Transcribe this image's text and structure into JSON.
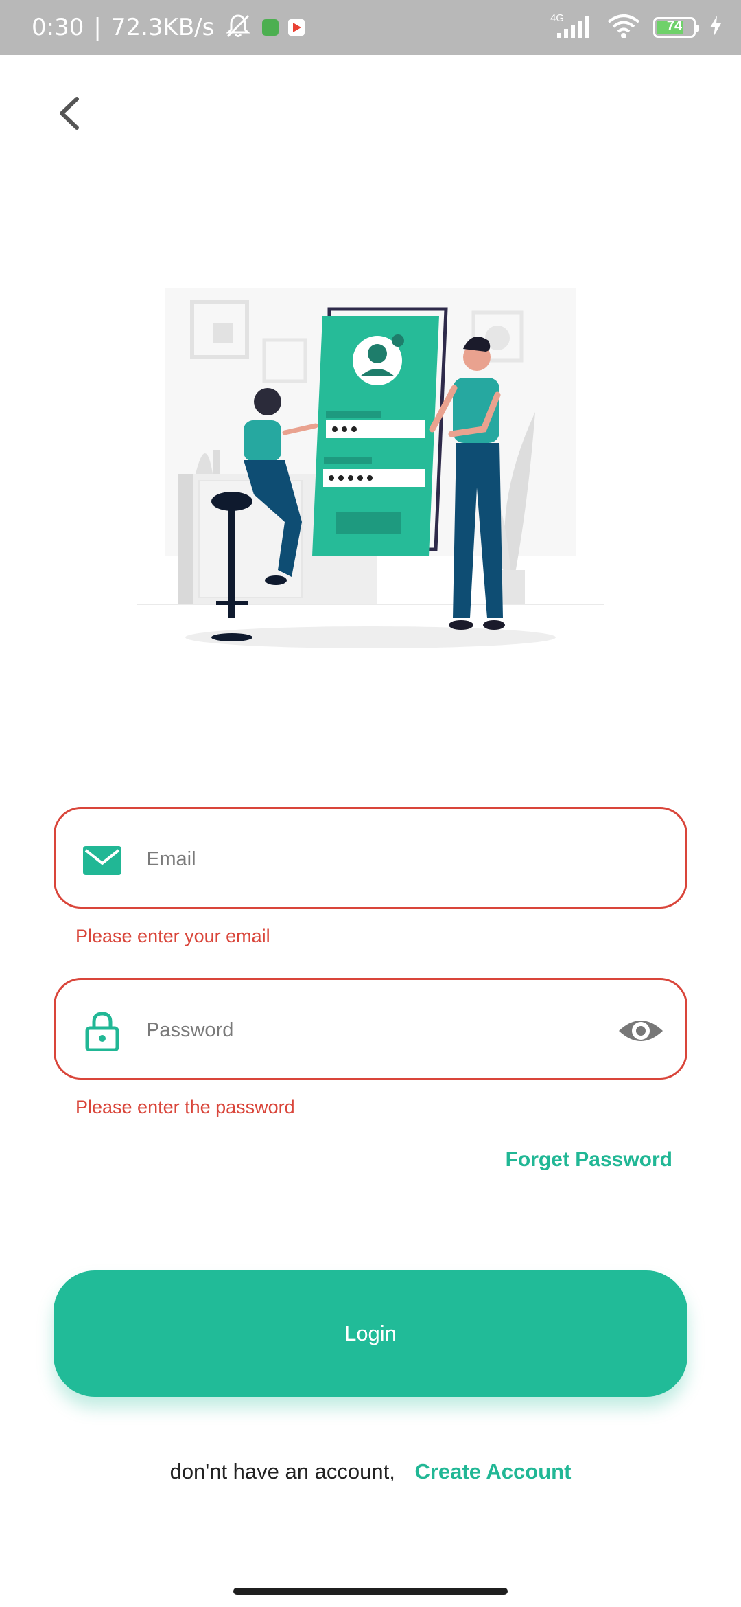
{
  "status_bar": {
    "time": "0:30",
    "separator": "|",
    "speed": "72.3KB/s",
    "network": "4G",
    "battery_level": "74"
  },
  "form": {
    "email_placeholder": "Email",
    "email_error": "Please enter your email",
    "password_placeholder": "Password",
    "password_error": "Please enter the password",
    "forget_password": "Forget Password",
    "login_label": "Login",
    "no_account_text": "don'nt have an account,",
    "create_account": "Create Account"
  },
  "colors": {
    "accent": "#21bb98",
    "error": "#d9453a",
    "status_bar": "#b8b8b8"
  },
  "icons": [
    "back-arrow-icon",
    "email-icon",
    "lock-icon",
    "eye-icon",
    "wifi-icon",
    "signal-icon",
    "battery-icon",
    "bell-off-icon",
    "charging-icon"
  ]
}
